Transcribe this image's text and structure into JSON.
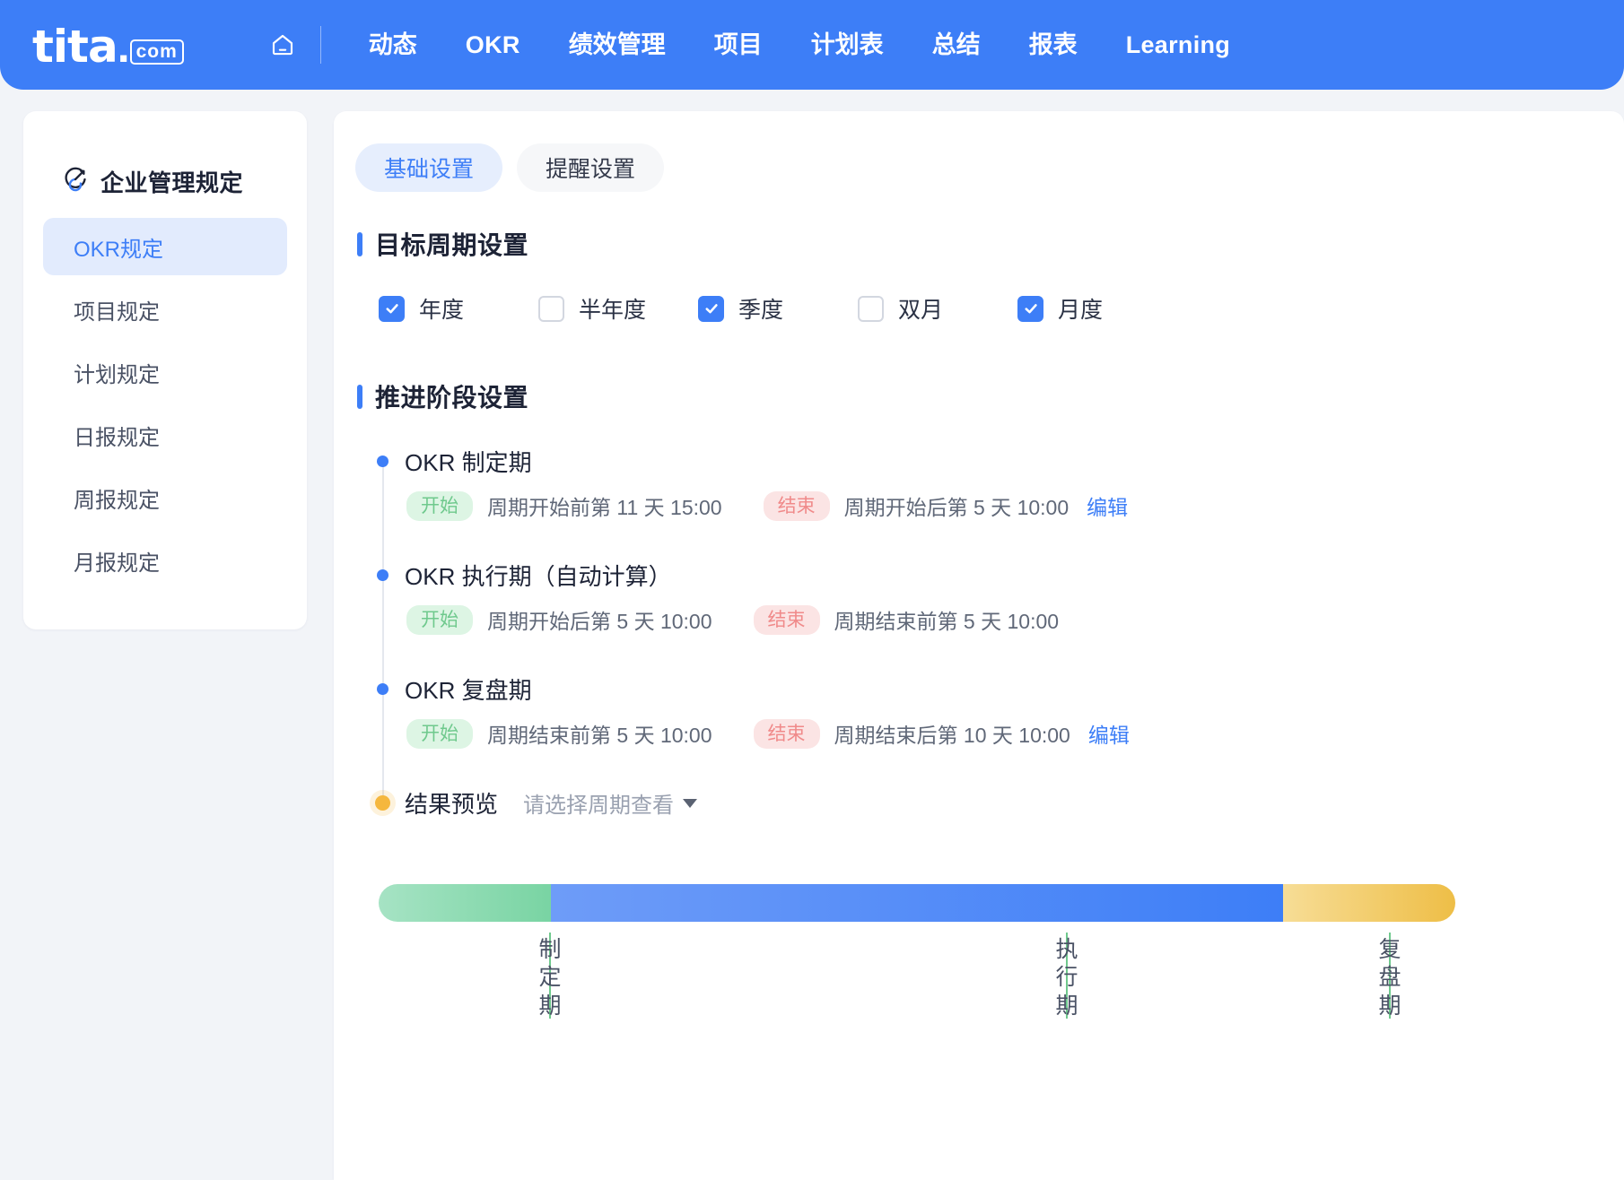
{
  "header": {
    "logo": {
      "word": "tita",
      "dot": ".",
      "badge": "com"
    },
    "home_icon": "home-icon",
    "nav": [
      {
        "label": "动态",
        "latin": false
      },
      {
        "label": "OKR",
        "latin": true
      },
      {
        "label": "绩效管理",
        "latin": false
      },
      {
        "label": "项目",
        "latin": false
      },
      {
        "label": "计划表",
        "latin": false
      },
      {
        "label": "总结",
        "latin": false
      },
      {
        "label": "报表",
        "latin": false
      },
      {
        "label": "Learning",
        "latin": true
      }
    ],
    "brand_color": "#3d7ef7"
  },
  "sidebar": {
    "icon": "target-gauge-icon",
    "title": "企业管理规定",
    "items": [
      {
        "label": "OKR规定",
        "active": true
      },
      {
        "label": "项目规定",
        "active": false
      },
      {
        "label": "计划规定",
        "active": false
      },
      {
        "label": "日报规定",
        "active": false
      },
      {
        "label": "周报规定",
        "active": false
      },
      {
        "label": "月报规定",
        "active": false
      }
    ]
  },
  "main": {
    "tabs": [
      {
        "label": "基础设置",
        "active": true
      },
      {
        "label": "提醒设置",
        "active": false
      }
    ],
    "cycle_section": {
      "title": "目标周期设置",
      "options": [
        {
          "label": "年度",
          "checked": true
        },
        {
          "label": "半年度",
          "checked": false
        },
        {
          "label": "季度",
          "checked": true
        },
        {
          "label": "双月",
          "checked": false
        },
        {
          "label": "月度",
          "checked": true
        }
      ]
    },
    "phase_section": {
      "title": "推进阶段设置",
      "start_chip": "开始",
      "end_chip": "结束",
      "edit_label": "编辑",
      "phases": [
        {
          "name": "OKR 制定期",
          "start_text": "周期开始前第 11 天 15:00",
          "end_text": "周期开始后第 5 天 10:00",
          "editable": true
        },
        {
          "name": "OKR 执行期（自动计算）",
          "start_text": "周期开始后第 5 天 10:00",
          "end_text": "周期结束前第 5 天 10:00",
          "editable": false
        },
        {
          "name": "OKR 复盘期",
          "start_text": "周期结束前第 5 天 10:00",
          "end_text": "周期结束后第 10 天 10:00",
          "editable": true
        }
      ],
      "preview": {
        "title": "结果预览",
        "select_placeholder": "请选择周期查看",
        "caret_icon": "chevron-down-icon"
      }
    }
  },
  "chart_data": {
    "type": "bar",
    "title": "结果预览",
    "orientation": "horizontal-stacked",
    "categories": [
      "制定期",
      "执行期",
      "复盘期"
    ],
    "values": [
      16,
      68,
      16
    ],
    "unit": "percent",
    "colors": [
      "#79d4a3",
      "#3d7ef7",
      "#eebe47"
    ],
    "tick_color": "#6fc98d",
    "label_positions_pct": [
      14,
      62,
      92
    ],
    "grid": false,
    "legend": "none"
  }
}
